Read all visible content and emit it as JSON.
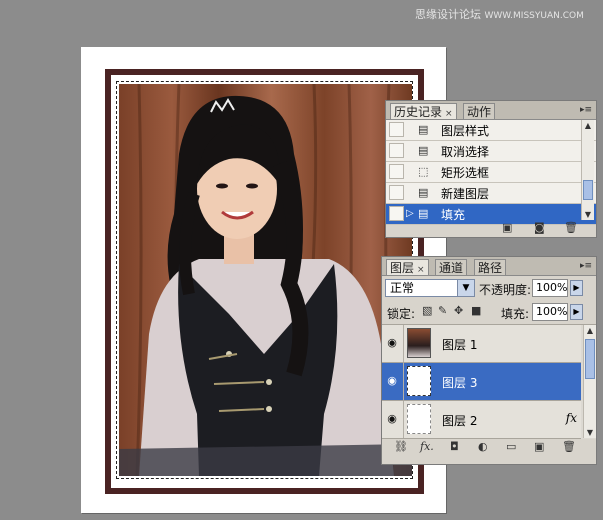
{
  "watermark": {
    "text": "思缘设计论坛",
    "url": "WWW.MISSYUAN.COM"
  },
  "history_panel": {
    "tabs": [
      {
        "label": "历史记录",
        "close": "×"
      },
      {
        "label": "动作"
      }
    ],
    "menu_icon": "▸≡",
    "items": [
      {
        "label": "图层样式",
        "icon": "state-icon"
      },
      {
        "label": "取消选择",
        "icon": "state-icon"
      },
      {
        "label": "矩形选框",
        "icon": "marquee-icon"
      },
      {
        "label": "新建图层",
        "icon": "state-icon"
      },
      {
        "label": "填充",
        "icon": "state-icon",
        "selected": true
      }
    ]
  },
  "layers_panel": {
    "tabs": [
      {
        "label": "图层",
        "close": "×"
      },
      {
        "label": "通道"
      },
      {
        "label": "路径"
      }
    ],
    "menu_icon": "▸≡",
    "blend_mode": "正常",
    "opacity_label": "不透明度:",
    "opacity_value": "100%",
    "lock_label": "锁定:",
    "fill_label": "填充:",
    "fill_value": "100%",
    "layers": [
      {
        "name": "图层 1",
        "thumb": "photo",
        "selected": false,
        "fx": ""
      },
      {
        "name": "图层 3",
        "thumb": "selection",
        "selected": true,
        "fx": ""
      },
      {
        "name": "图层 2",
        "thumb": "blank",
        "selected": false,
        "fx": "fx"
      }
    ],
    "footer_fx": "fx."
  }
}
